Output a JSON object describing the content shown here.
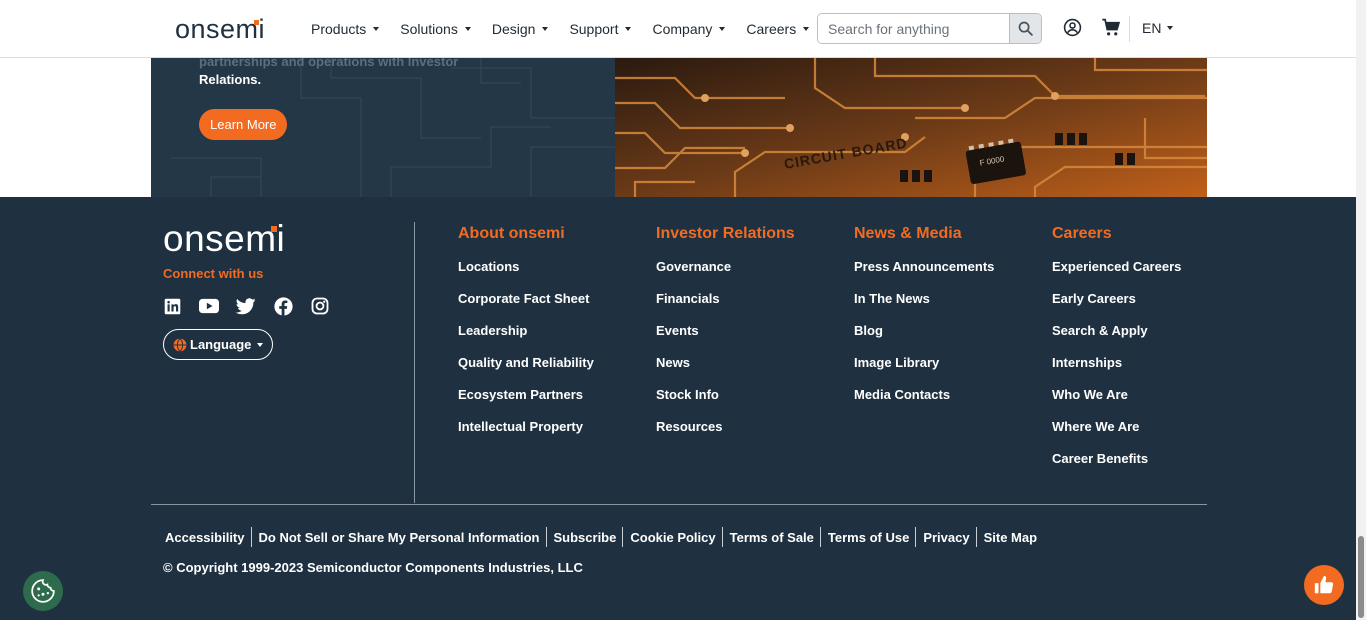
{
  "header": {
    "logo": "onsemi",
    "nav": [
      "Products",
      "Solutions",
      "Design",
      "Support",
      "Company",
      "Careers"
    ],
    "search_placeholder": "Search for anything",
    "language": "EN",
    "icons": [
      "search-icon",
      "account-icon",
      "cart-icon"
    ]
  },
  "hero": {
    "text_line": "Relations.",
    "faded_line": "partnerships and operations with Investor",
    "button": "Learn More",
    "board_label": "CIRCUIT BOARD",
    "chip_label": "F 0000"
  },
  "footer": {
    "logo": "onsemi",
    "connect": "Connect with us",
    "social": [
      "linkedin-icon",
      "youtube-icon",
      "twitter-icon",
      "facebook-icon",
      "instagram-icon"
    ],
    "language_button": "Language",
    "columns": [
      {
        "title": "About onsemi",
        "links": [
          "Locations",
          "Corporate Fact Sheet",
          "Leadership",
          "Quality and Reliability",
          "Ecosystem Partners",
          "Intellectual Property"
        ]
      },
      {
        "title": "Investor Relations",
        "links": [
          "Governance",
          "Financials",
          "Events",
          "News",
          "Stock Info",
          "Resources"
        ]
      },
      {
        "title": "News & Media",
        "links": [
          "Press Announcements",
          "In The News",
          "Blog",
          "Image Library",
          "Media Contacts"
        ]
      },
      {
        "title": "Careers",
        "links": [
          "Experienced Careers",
          "Early Careers",
          "Search & Apply",
          "Internships",
          "Who We Are",
          "Where We Are",
          "Career Benefits"
        ]
      }
    ],
    "bottom_links": [
      "Accessibility",
      "Do Not Sell or Share My Personal Information",
      "Subscribe",
      "Cookie Policy",
      "Terms of Sale",
      "Terms of Use",
      "Privacy",
      "Site Map"
    ],
    "copyright": "© Copyright 1999-2023 Semiconductor Components Industries, LLC"
  },
  "colors": {
    "accent": "#f26b21",
    "navy": "#1f3141"
  }
}
